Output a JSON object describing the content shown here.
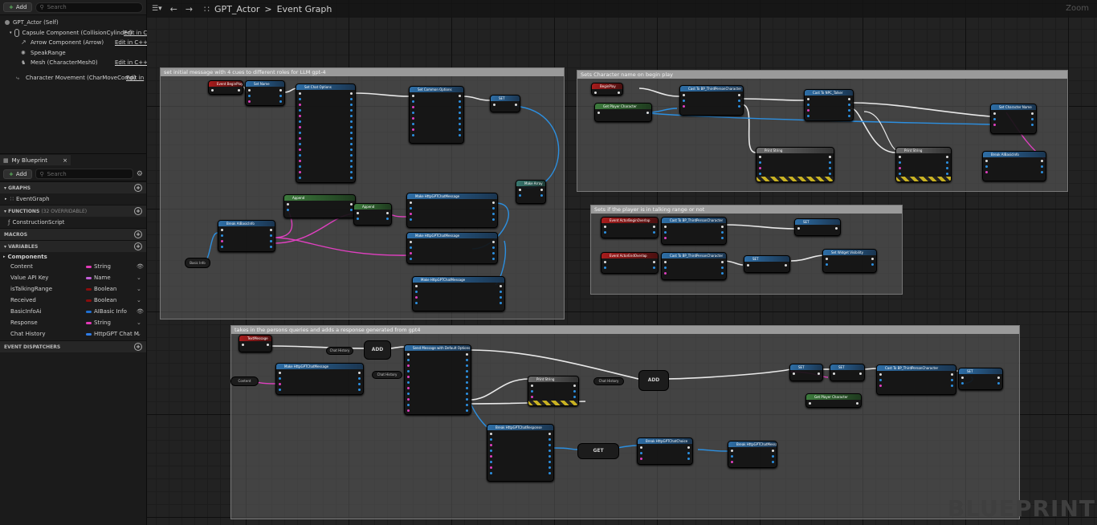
{
  "components_panel": {
    "add_label": "Add",
    "search_placeholder": "Search",
    "rows": [
      {
        "label": "GPT_Actor (Self)",
        "edit": ""
      },
      {
        "label": "Capsule Component (CollisionCylinder)",
        "edit": "Edit in C"
      },
      {
        "label": "Arrow Component (Arrow)",
        "edit": "Edit in C++"
      },
      {
        "label": "SpeakRange",
        "edit": ""
      },
      {
        "label": "Mesh (CharacterMesh0)",
        "edit": "Edit in C++"
      },
      {
        "label": "Character Movement (CharMoveComp)",
        "edit": "Edit in"
      }
    ]
  },
  "blueprint_panel": {
    "tab_label": "My Blueprint",
    "add_label": "Add",
    "search_placeholder": "Search",
    "graphs_header": "GRAPHS",
    "graph_item": "EventGraph",
    "functions_header": "FUNCTIONS",
    "functions_count": "(32 OVERRIDABLE)",
    "function_item": "ConstructionScript",
    "macros_header": "MACROS",
    "variables_header": "VARIABLES",
    "components_group": "Components",
    "variables": [
      {
        "name": "Content",
        "type": "String",
        "color": "#e33ab8",
        "vis": "eye"
      },
      {
        "name": "Value API Key",
        "type": "Name",
        "color": "#c35ed8",
        "vis": "chevron"
      },
      {
        "name": "isTalkingRange",
        "type": "Boolean",
        "color": "#8b0d0d",
        "vis": "chevron"
      },
      {
        "name": "Received",
        "type": "Boolean",
        "color": "#8b0d0d",
        "vis": "chevron"
      },
      {
        "name": "BasicInfoAi",
        "type": "AIBasic Info",
        "color": "#1f6fd1",
        "vis": "eye"
      },
      {
        "name": "Response",
        "type": "String",
        "color": "#e33ab8",
        "vis": "chevron"
      },
      {
        "name": "Chat History",
        "type": "HttpGPT Chat M",
        "color": "#2f7de8",
        "vis": "chevron"
      }
    ],
    "dispatchers_header": "EVENT DISPATCHERS"
  },
  "graph": {
    "breadcrumb_root": "GPT_Actor",
    "breadcrumb_sep": ">",
    "breadcrumb_page": "Event Graph",
    "zoom_label": "Zoom",
    "watermark": "BLUEPRINT",
    "comments": [
      "set initial message with 4 cues to different roles for LLM gpt-4",
      "Sets Character name on begin play",
      "Sets if the player is in talking range or not",
      "takes in the persons queries and adds a response generated from gpt4"
    ],
    "nodes": {
      "event_begin_play": "Event BeginPlay",
      "set_name": "Set Name",
      "set_chat_options": "Set Chat Options",
      "set_common_options": "Set Common Options",
      "set1": "SET",
      "break_aibasicinfo": "Break AIBasicInfo",
      "append": "Append",
      "append2": "Append",
      "make_msg1": "Make HttpGPTChatMessage",
      "make_msg2": "Make HttpGPTChatMessage",
      "make_msg3": "Make HttpGPTChatMessage",
      "make_array": "Make Array",
      "basic_info": "Basic Info",
      "beg_play2": "BeginPlay",
      "get_player_char": "Get Player Character",
      "cast_tpc": "Cast To BP_ThirdPersonCharacter",
      "cast_npc": "Cast To NPC_Talker",
      "set_char_name": "Set Character Name",
      "print_string": "Print String",
      "print_string2": "Print String",
      "break_aibasicinfo2": "Break AIBasicInfo",
      "overlap_begin": "Event ActorBeginOverlap",
      "overlap_end": "Event ActorEndOverlap",
      "cast_tpc2": "Cast To BP_ThirdPersonCharacter",
      "cast_tpc3": "Cast To BP_ThirdPersonCharacter",
      "set_talk1": "SET",
      "set_talk2": "SET",
      "widget_vis": "Set Widget Visibility",
      "text_msg": "TextMessage",
      "chat_history": "Chat History",
      "add1": "ADD",
      "send_msg": "Send Message with Default Options",
      "make_msg4": "Make HttpGPTChatMessage",
      "content_var": "Content",
      "chat_history2": "Chat History",
      "print_string3": "Print String",
      "chat_history3": "Chat History",
      "add2": "ADD",
      "set_resp": "SET",
      "set_recv": "SET",
      "cast_tpc4": "Cast To BP_ThirdPersonCharacter",
      "set_end": "SET",
      "get_player_char2": "Get Player Character",
      "break_response": "Break HttpGPTChatResponse",
      "get_node": "GET",
      "break_choice": "Break HttpGPTChatChoice",
      "break_msg": "Break HttpGPTChatMessage"
    }
  }
}
